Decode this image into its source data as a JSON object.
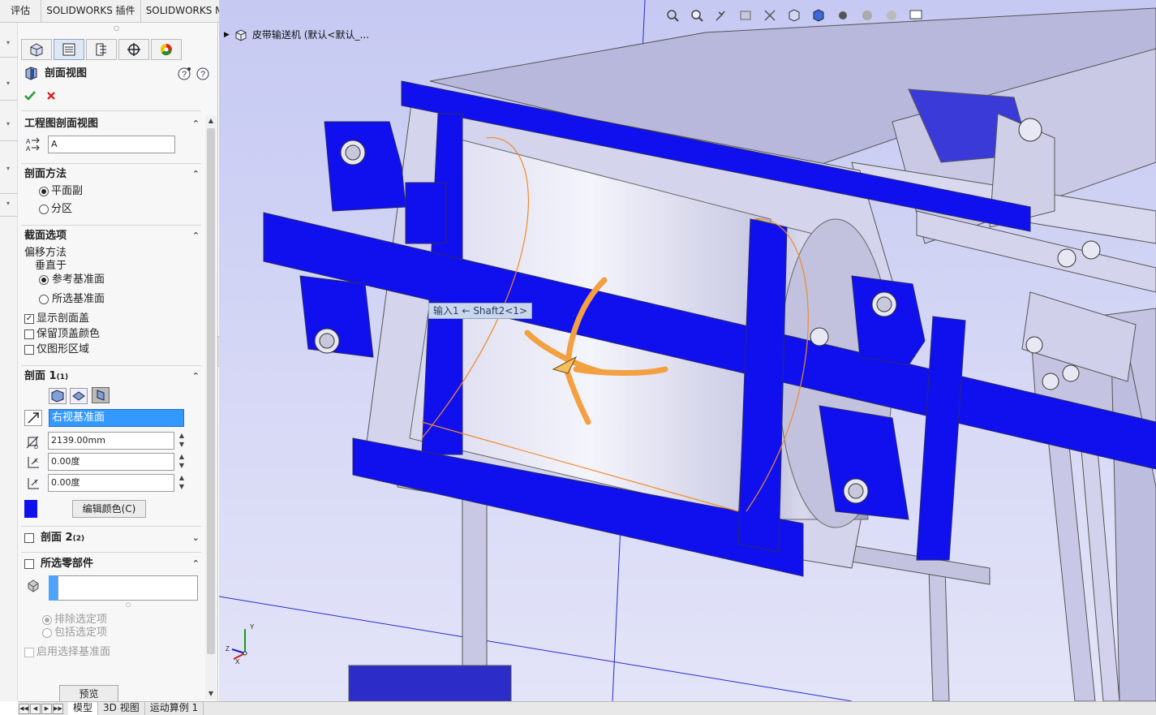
{
  "command_tabs": [
    "评估",
    "SOLIDWORKS 插件",
    "SOLIDWORKS MBD"
  ],
  "panel": {
    "title": "剖面视图",
    "drawing_section": {
      "header": "工程图剖面视图",
      "label_value": "A"
    },
    "section_method": {
      "header": "剖面方法",
      "options": [
        "平面副",
        "分区"
      ],
      "selected": "平面副"
    },
    "section_options": {
      "header": "截面选项",
      "offset_label": "偏移方法",
      "perpendicular_label": "垂直于",
      "options": [
        "参考基准面",
        "所选基准面"
      ],
      "selected": "参考基准面",
      "checkboxes": [
        {
          "label": "显示剖面盖",
          "checked": true
        },
        {
          "label": "保留顶盖颜色",
          "checked": false
        },
        {
          "label": "仅图形区域",
          "checked": false
        }
      ]
    },
    "section1": {
      "header": "剖面 1",
      "header_suffix": "(1)",
      "plane": "右视基准面",
      "offset": "2139.00mm",
      "angle_x": "0.00度",
      "angle_y": "0.00度",
      "cap_color": "#1010ee",
      "edit_color_button": "编辑颜色(C)"
    },
    "section2": {
      "header": "剖面 2",
      "header_suffix": "(2)",
      "checked": false
    },
    "selected_components": {
      "header": "所选零部件",
      "options": [
        "排除选定项",
        "包括选定项"
      ],
      "selected": "排除选定项",
      "enable_plane_label": "启用选择基准面"
    },
    "preview_button": "预览"
  },
  "bottom_tabs": [
    "模型",
    "3D 视图",
    "运动算例 1"
  ],
  "active_bottom_tab": "模型",
  "viewport": {
    "document_name": "皮带输送机 (默认<默认_...",
    "tooltip": "输入1 ← Shaft2<1>",
    "axis_labels": {
      "x": "X",
      "y": "Y",
      "z": "Z"
    },
    "colors": {
      "background_top": "#c6c9f2",
      "background_bottom": "#e3e4f8",
      "section_cap": "#1010ee",
      "frame": "#bdbde0",
      "highlight": "#f0a040"
    }
  }
}
